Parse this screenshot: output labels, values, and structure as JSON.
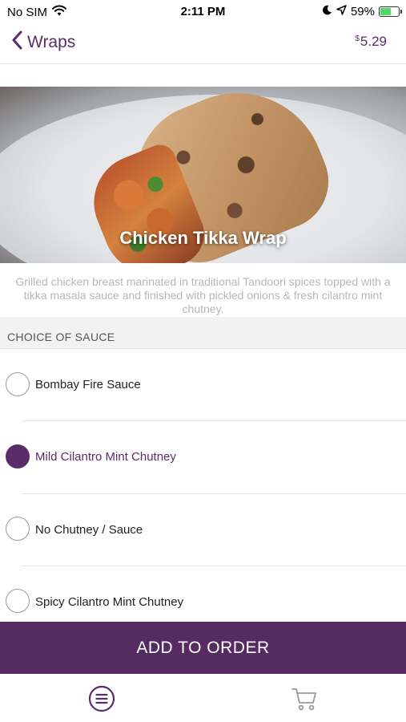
{
  "status_bar": {
    "carrier": "No SIM",
    "time": "2:11 PM",
    "battery_percent": "59%",
    "battery_level": 0.59,
    "icons": [
      "wifi-icon",
      "moon-icon",
      "location-arrow-icon",
      "battery-icon"
    ]
  },
  "nav": {
    "back_label": "Wraps",
    "price_currency": "$",
    "price_value": "5.29"
  },
  "item": {
    "title": "Chicken Tikka Wrap",
    "description": "Grilled chicken breast marinated in traditional Tandoori spices topped with a tikka masala sauce and finished with pickled onions & fresh cilantro mint chutney."
  },
  "sauce_section": {
    "header": "CHOICE OF SAUCE",
    "options": [
      {
        "label": "Bombay Fire Sauce",
        "selected": false
      },
      {
        "label": "Mild Cilantro Mint Chutney",
        "selected": true
      },
      {
        "label": "No Chutney / Sauce",
        "selected": false
      },
      {
        "label": "Spicy Cilantro Mint Chutney",
        "selected": false
      }
    ]
  },
  "action": {
    "add_label": "ADD TO ORDER"
  },
  "tabs": [
    {
      "icon": "menu-list-icon"
    },
    {
      "icon": "cart-icon"
    }
  ],
  "colors": {
    "accent": "#5a2d6a",
    "button": "#562b61",
    "description_text": "#b7b7b7"
  }
}
